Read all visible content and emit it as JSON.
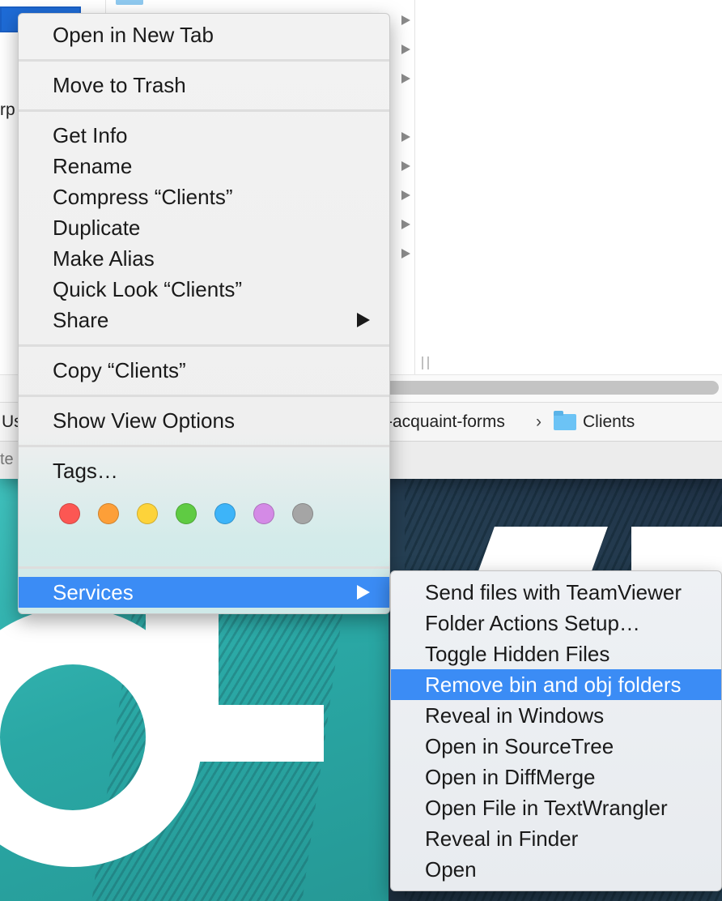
{
  "finder": {
    "path_fragment_left": "Us",
    "path_fragment_mid": "-acquaint-forms",
    "path_separator": "›",
    "current_folder": "Clients",
    "sidebar_fragment": "rp",
    "status_fragment": "te"
  },
  "context_menu": {
    "open_new_tab": "Open in New Tab",
    "move_to_trash": "Move to Trash",
    "get_info": "Get Info",
    "rename": "Rename",
    "compress": "Compress “Clients”",
    "duplicate": "Duplicate",
    "make_alias": "Make Alias",
    "quick_look": "Quick Look “Clients”",
    "share": "Share",
    "copy": "Copy “Clients”",
    "show_view_options": "Show View Options",
    "tags": "Tags…",
    "services": "Services"
  },
  "tag_colors": [
    "#fc5753",
    "#fd9f38",
    "#fdd33a",
    "#5fcb43",
    "#3db4f9",
    "#d48ae6",
    "#a5a5a5"
  ],
  "services_submenu": {
    "items": [
      "Send files with TeamViewer",
      "Folder Actions Setup…",
      "Toggle Hidden Files",
      "Remove bin and obj folders",
      "Reveal in Windows",
      "Open in SourceTree",
      "Open in DiffMerge",
      "Open File in TextWrangler",
      "Reveal in Finder",
      "Open"
    ],
    "highlighted_index": 3
  },
  "colors": {
    "highlight": "#3b8cf5",
    "selection": "#1e6bd6",
    "folder": "#6cc3f5"
  }
}
